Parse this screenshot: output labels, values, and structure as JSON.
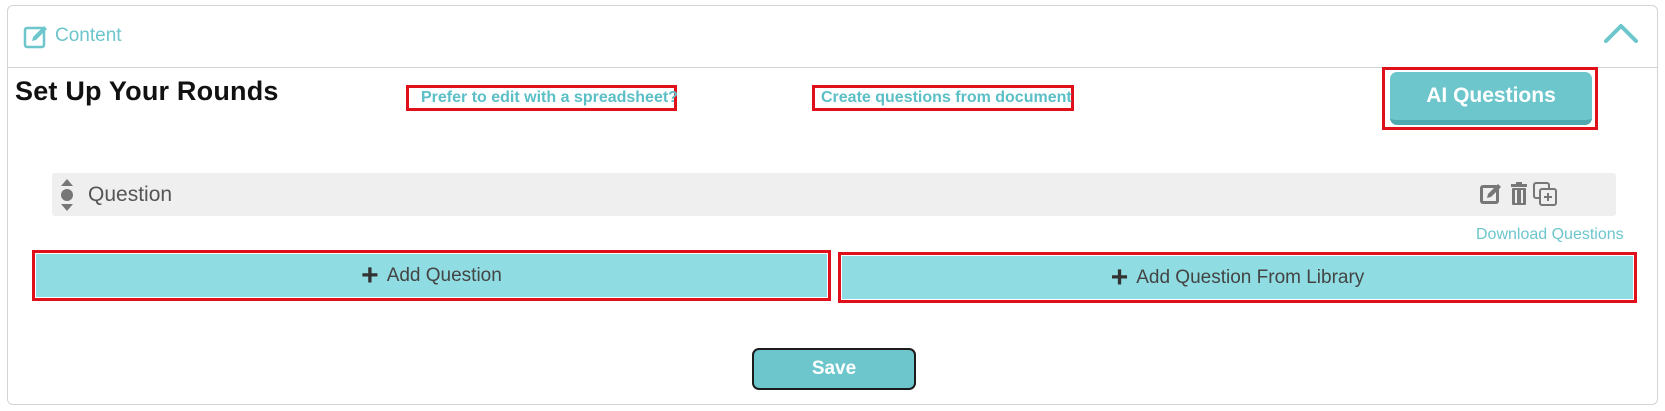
{
  "panel": {
    "header_title": "Content",
    "header_icon": "edit-icon",
    "collapse_icon": "chevron-up-icon"
  },
  "rounds": {
    "title": "Set Up Your Rounds",
    "spreadsheet_link": "Prefer to edit with a spreadsheet?",
    "document_link": "Create questions from document",
    "ai_button": "AI Questions"
  },
  "question_row": {
    "label": "Question",
    "icons": [
      "edit-icon",
      "trash-icon",
      "duplicate-icon"
    ]
  },
  "download_link": "Download Questions",
  "add_question": "Add Question",
  "add_from_library": "Add Question From Library",
  "save": "Save",
  "colors": {
    "accent": "#6cc6cc",
    "add_button_bg": "#8fdde3",
    "highlight": "#e0101a"
  }
}
